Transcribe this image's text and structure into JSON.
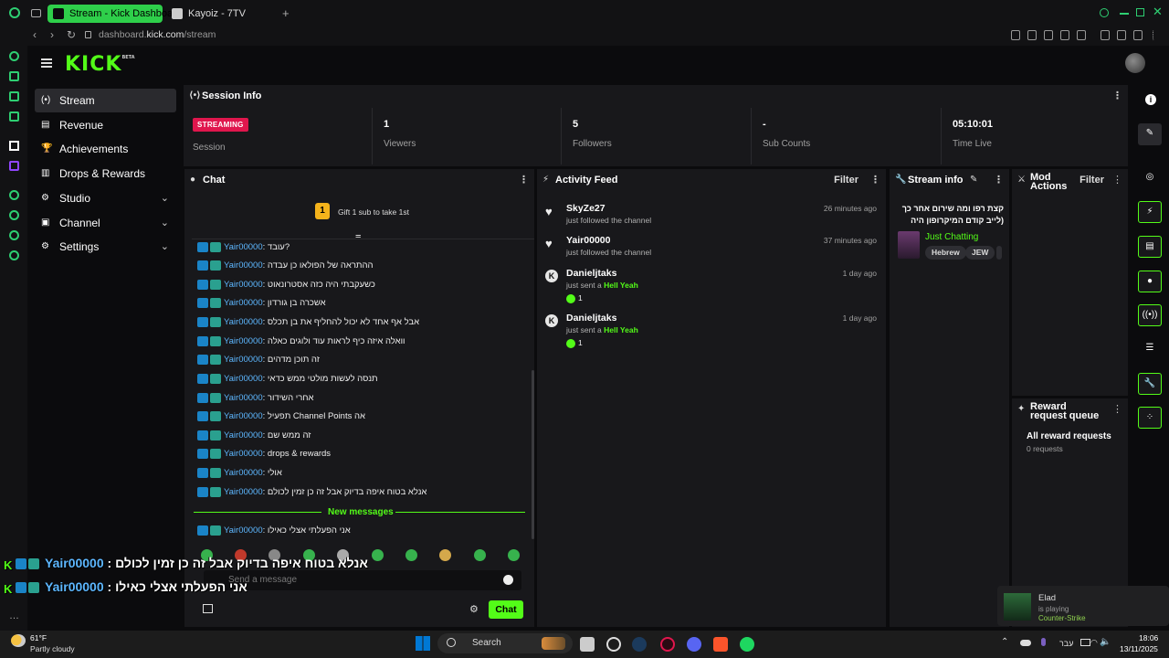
{
  "browser": {
    "tabs": [
      {
        "label": "Stream - Kick Dashboard",
        "active": true
      },
      {
        "label": "Kayoiz - 7TV",
        "active": false
      }
    ],
    "url_prefix": "dashboard.",
    "url_domain": "kick.com",
    "url_path": "/stream"
  },
  "app": {
    "logo": "KICK",
    "logo_badge": "BETA"
  },
  "nav": [
    {
      "label": "Stream",
      "active": true,
      "icon": "(•)"
    },
    {
      "label": "Revenue",
      "icon": "▤"
    },
    {
      "label": "Achievements",
      "icon": "🏆"
    },
    {
      "label": "Drops & Rewards",
      "icon": "▥"
    },
    {
      "label": "Studio",
      "icon": "⚙",
      "chevron": true
    },
    {
      "label": "Channel",
      "icon": "▣",
      "chevron": true
    },
    {
      "label": "Settings",
      "icon": "⚙",
      "chevron": true
    }
  ],
  "session": {
    "title": "Session Info",
    "status_badge": "STREAMING",
    "status_label": "Session",
    "stats": [
      {
        "value": "1",
        "label": "Viewers"
      },
      {
        "value": "5",
        "label": "Followers"
      },
      {
        "value": "-",
        "label": "Sub Counts"
      },
      {
        "value": "05:10:01",
        "label": "Time Live"
      }
    ]
  },
  "chat": {
    "title": "Chat",
    "gift_rank": "1",
    "gift_text": "Gift 1 sub to take 1st",
    "messages": [
      {
        "user": "Yair00000",
        "text": "עובד?"
      },
      {
        "user": "Yair00000",
        "text": "ההתראה של הפולאו כן עבדה"
      },
      {
        "user": "Yair00000",
        "text": "כשעקבתי היה כזה אסטרונאוט"
      },
      {
        "user": "Yair00000",
        "text": "אשכרה בן גורדון"
      },
      {
        "user": "Yair00000",
        "text": "אבל אף אחד לא יכול להחליף את בן תכלס"
      },
      {
        "user": "Yair00000",
        "text": "וואלה איזה כיף לראות עוד ולוגים כאלה"
      },
      {
        "user": "Yair00000",
        "text": "זה תוכן מדהים"
      },
      {
        "user": "Yair00000",
        "text": "תנסה לעשות מולטי ממש כדאי"
      },
      {
        "user": "Yair00000",
        "text": "אחרי השידור"
      },
      {
        "user": "Yair00000",
        "text": "תפעיל Channel Points אה"
      },
      {
        "user": "Yair00000",
        "text": "זה ממש שם"
      },
      {
        "user": "Yair00000",
        "text": "drops & rewards"
      },
      {
        "user": "Yair00000",
        "text": "אולי"
      },
      {
        "user": "Yair00000",
        "text": "אנלא בטוח איפה בדיוק אבל זה כן זמין לכולם"
      }
    ],
    "new_messages_label": "New messages",
    "new_message": {
      "user": "Yair00000",
      "text": "אני הפעלתי אצלי כאילו"
    },
    "input_placeholder": "Send a message",
    "send_label": "Chat"
  },
  "activity": {
    "title": "Activity Feed",
    "filter_label": "Filter",
    "items": [
      {
        "name": "SkyZe27",
        "desc": "just followed the channel",
        "time": "26 minutes ago",
        "type": "follow"
      },
      {
        "name": "Yair00000",
        "desc": "just followed the channel",
        "time": "37 minutes ago",
        "type": "follow"
      },
      {
        "name": "Danieljtaks",
        "desc": "just sent a",
        "highlight": "Hell Yeah",
        "time": "1 day ago",
        "type": "kick",
        "count": "1"
      },
      {
        "name": "Danieljtaks",
        "desc": "just sent a",
        "highlight": "Hell Yeah",
        "time": "1 day ago",
        "type": "kick",
        "count": "1"
      }
    ]
  },
  "stream_info": {
    "title": "Stream info",
    "stream_title": "קצת רפו ומה שירום אחר כך (לייב קודם המיקרופון היה",
    "category": "Just Chatting",
    "tags": [
      "Hebrew",
      "JEW"
    ]
  },
  "mod_actions": {
    "title": "Mod Actions",
    "filter_label": "Filter"
  },
  "reward_queue": {
    "title": "Reward request queue",
    "heading": "All reward requests",
    "count": "0 requests"
  },
  "overlay": [
    {
      "user": "Yair00000",
      "text": "אנלא בטוח איפה בדיוק אבל זה כן זמין לכולם"
    },
    {
      "user": "Yair00000",
      "text": "אני הפעלתי אצלי כאילו"
    }
  ],
  "notification": {
    "name": "Elad",
    "status": "is playing",
    "game": "Counter-Strike"
  },
  "taskbar": {
    "weather_temp": "61°F",
    "weather_desc": "Partly cloudy",
    "search_label": "Search",
    "lang": "עבר",
    "time": "18:06",
    "date": "13/11/2025"
  },
  "colors": {
    "accent": "#53fc18",
    "streaming_badge": "#e0164d",
    "username": "#5db7ff"
  }
}
